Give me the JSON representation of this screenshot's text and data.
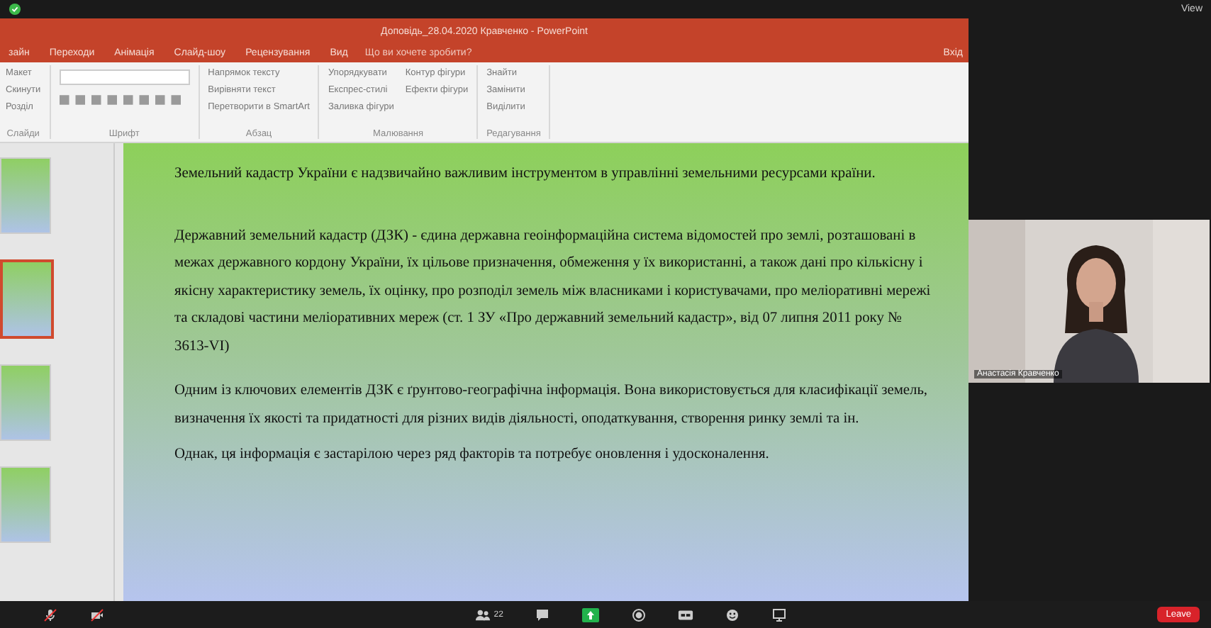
{
  "top_bar": {
    "view_label": "View"
  },
  "window": {
    "title": "Доповідь_28.04.2020 Кравченко - PowerPoint",
    "sign_in": "Вхід"
  },
  "tabs": [
    {
      "label": "зайн",
      "selected": false
    },
    {
      "label": "Переходи",
      "selected": false
    },
    {
      "label": "Анімація",
      "selected": false
    },
    {
      "label": "Слайд-шоу",
      "selected": false
    },
    {
      "label": "Рецензування",
      "selected": false
    },
    {
      "label": "Вид",
      "selected": false
    }
  ],
  "tell_me": {
    "placeholder": "Що ви хочете зробити?"
  },
  "ribbon_groups": [
    {
      "name": "Слайди",
      "items": [
        "Макет",
        "Скинути",
        "Розділ"
      ]
    },
    {
      "name": "Шрифт"
    },
    {
      "name": "Абзац",
      "items": [
        "Напрямок тексту",
        "Вирівняти текст",
        "Перетворити в SmartArt"
      ]
    },
    {
      "name": "Малювання",
      "items": [
        "Упорядкувати",
        "Експрес-стилі",
        "Заливка фігури",
        "Контур фігури",
        "Ефекти фігури"
      ]
    },
    {
      "name": "Редагування",
      "items": [
        "Знайти",
        "Замінити",
        "Виділити"
      ]
    }
  ],
  "thumbnails": [
    {
      "selected": false
    },
    {
      "selected": true
    },
    {
      "selected": false
    },
    {
      "selected": false
    }
  ],
  "slide": {
    "paragraphs": [
      "Земельний кадастр України є надзвичайно важливим інструментом в управлінні земельними ресурсами країни.",
      "Державний земельний кадастр (ДЗК) -  єдина державна геоінформаційна система відомостей про землі, розташовані в межах державного кордону України, їх цільове призначення, обмеження у їх використанні, а також дані про кількісну і якісну характеристику земель, їх оцінку, про розподіл земель між власниками і користувачами, про меліоративні мережі та складові частини меліоративних мереж (ст. 1 ЗУ «Про державний земельний кадастр», від 07 липня 2011 року № 3613-VI)",
      "Одним із ключових елементів ДЗК є ґрунтово-географічна інформація. Вона використовується для класифікації земель, визначення їх якості та придатності для різних видів діяльності, оподаткування, створення ринку землі та ін.",
      "Однак, ця інформація є застарілою через ряд факторів та потребує оновлення і удосконалення."
    ]
  },
  "participant": {
    "name": "Анастасія Кравченко"
  },
  "toolbar": {
    "participants_count": "22",
    "leave": "Leave"
  }
}
